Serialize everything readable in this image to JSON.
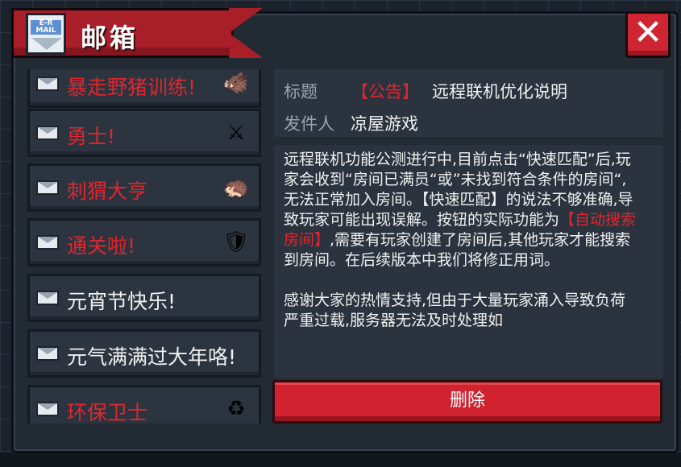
{
  "window": {
    "title": "邮箱"
  },
  "mail_icon_tag": "E-R MAIL",
  "close_label": "✕",
  "mail_list": [
    {
      "label": "暴走野猪训练!",
      "color": "red",
      "thumb": "🐗"
    },
    {
      "label": "勇士!",
      "color": "red",
      "thumb": "⚔"
    },
    {
      "label": "刺猬大亨",
      "color": "red",
      "thumb": "🦔"
    },
    {
      "label": "通关啦!",
      "color": "red",
      "thumb": "🛡"
    },
    {
      "label": "元宵节快乐!",
      "color": "white",
      "thumb": ""
    },
    {
      "label": "元气满满过大年咯!",
      "color": "white",
      "thumb": ""
    },
    {
      "label": "环保卫士",
      "color": "red",
      "thumb": "♻"
    }
  ],
  "detail": {
    "subject_label": "标题",
    "subject_tag": "【公告】",
    "subject_text": "远程联机优化说明",
    "sender_label": "发件人",
    "sender_name": "凉屋游戏",
    "body_part1": "远程联机功能公测进行中,目前点击“快速匹配”后,玩家会收到“房间已满员“或”未找到符合条件的房间“,无法正常加入房间。【快速匹配】的说法不够准确,导致玩家可能出现误解。按钮的实际功能为",
    "body_highlight": "【自动搜索房间】",
    "body_part2": ",需要有玩家创建了房间后,其他玩家才能搜索到房间。在后续版本中我们将修正用词。",
    "body_part3": "感谢大家的热情支持,但由于大量玩家涌入导致负荷严重过载,服务器无法及时处理如"
  },
  "delete_label": "删除",
  "colors": {
    "accent_red": "#d0222f",
    "highlight_red": "#e0262f",
    "panel": "#222a34"
  }
}
